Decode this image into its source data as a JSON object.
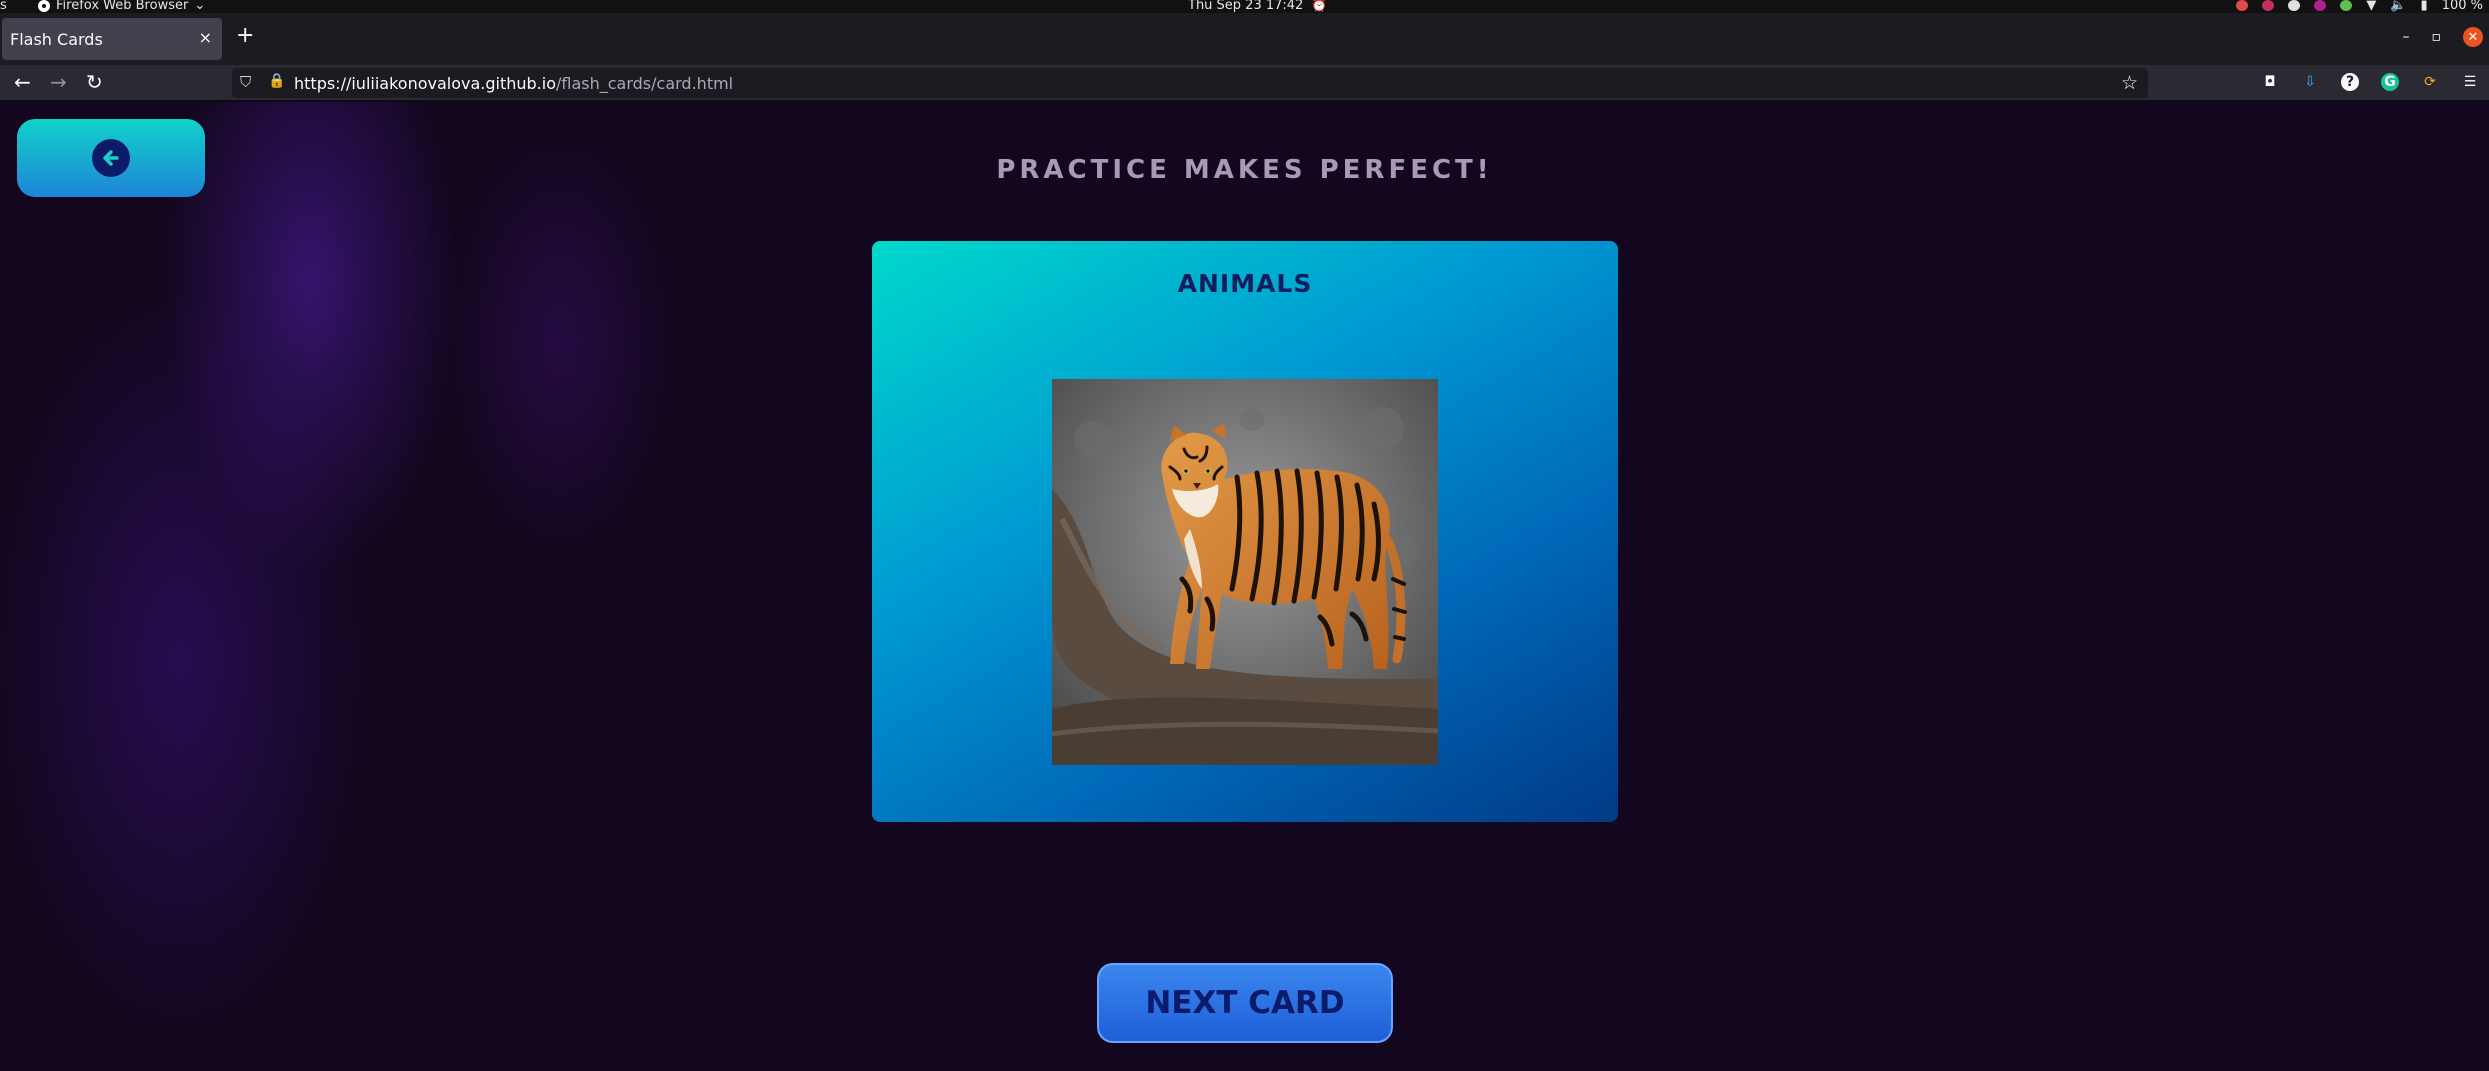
{
  "os": {
    "activities": "s",
    "app_name": "Firefox Web Browser",
    "app_chevron": "⌄",
    "clock": "Thu Sep 23  17:42",
    "battery": "100 %"
  },
  "browser": {
    "tab_title": "Flash Cards",
    "tab_close": "×",
    "new_tab": "+",
    "url_host": "https://iuliiakonovalova.github.io",
    "url_path": "/flash_cards/card.html"
  },
  "page": {
    "title": "PRACTICE MAKES PERFECT!",
    "card_category": "ANIMALS",
    "card_image_subject": "tiger",
    "next_button": "NEXT CARD"
  },
  "colors": {
    "page_bg": "#13071f",
    "back_button_top": "#10d3c9",
    "back_button_bottom": "#1e84d8",
    "card_gradient_start": "#00d8cb",
    "card_gradient_end": "#003a86",
    "next_button": "#2b72e6",
    "title_text": "#a79ab7"
  },
  "icons": {
    "back": "arrow-left-circle-icon",
    "image": "tiger-photo",
    "shield": "shield-icon",
    "lock": "lock-icon",
    "bookmark": "star-icon"
  }
}
